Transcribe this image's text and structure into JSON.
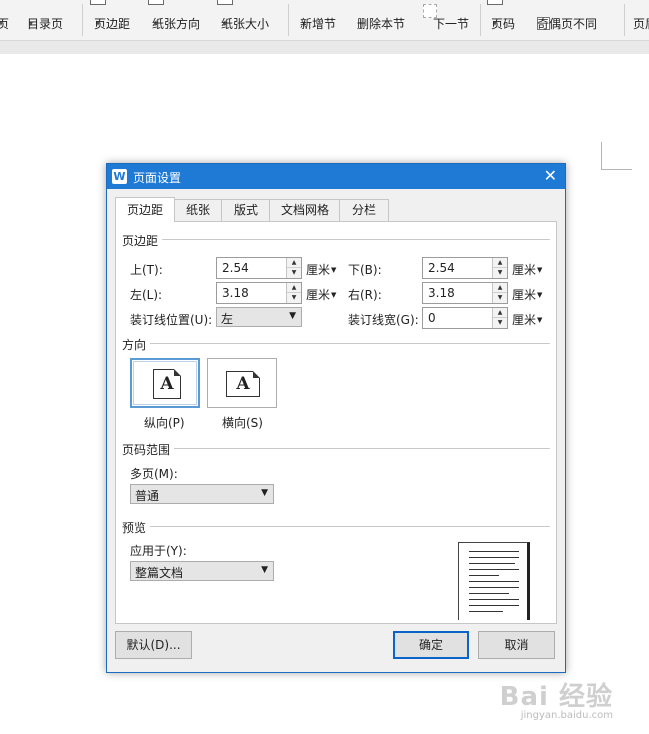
{
  "ribbon": {
    "items": [
      {
        "label": "页",
        "caret": "▾"
      },
      {
        "label": "目录页",
        "caret": "▾"
      },
      {
        "label": "页边距",
        "caret": "▾"
      },
      {
        "label": "纸张方向",
        "caret": "▾"
      },
      {
        "label": "纸张大小",
        "caret": "▾"
      },
      {
        "label": "新增节",
        "caret": "▾"
      },
      {
        "label": "删除本节",
        "caret": "▾"
      },
      {
        "label": "下一节",
        "caret": ""
      },
      {
        "label": "页码",
        "caret": "▾"
      },
      {
        "label": "奇偶页不同",
        "caret": ""
      },
      {
        "label": "页眉",
        "caret": ""
      }
    ]
  },
  "dialog": {
    "title": "页面设置",
    "app_icon_letter": "W",
    "close": "✕",
    "tabs": [
      "页边距",
      "纸张",
      "版式",
      "文档网格",
      "分栏"
    ],
    "margins": {
      "section": "页边距",
      "top_label": "上(T):",
      "top_value": "2.54",
      "bottom_label": "下(B):",
      "bottom_value": "2.54",
      "left_label": "左(L):",
      "left_value": "3.18",
      "right_label": "右(R):",
      "right_value": "3.18",
      "gutter_pos_label": "装订线位置(U):",
      "gutter_pos_value": "左",
      "gutter_width_label": "装订线宽(G):",
      "gutter_width_value": "0",
      "unit": "厘米"
    },
    "orientation": {
      "section": "方向",
      "portrait_label": "纵向(P)",
      "landscape_label": "横向(S)",
      "glyph": "A"
    },
    "pages": {
      "section": "页码范围",
      "multi_label": "多页(M):",
      "multi_value": "普通"
    },
    "preview": {
      "section": "预览",
      "apply_label": "应用于(Y):",
      "apply_value": "整篇文档"
    },
    "buttons": {
      "default": "默认(D)...",
      "ok": "确定",
      "cancel": "取消"
    }
  },
  "watermark": {
    "brand": "Bai 经验",
    "url": "jingyan.baidu.com"
  },
  "colors": {
    "titlebar": "#1f7ad6",
    "selection": "#5b9bd5"
  }
}
